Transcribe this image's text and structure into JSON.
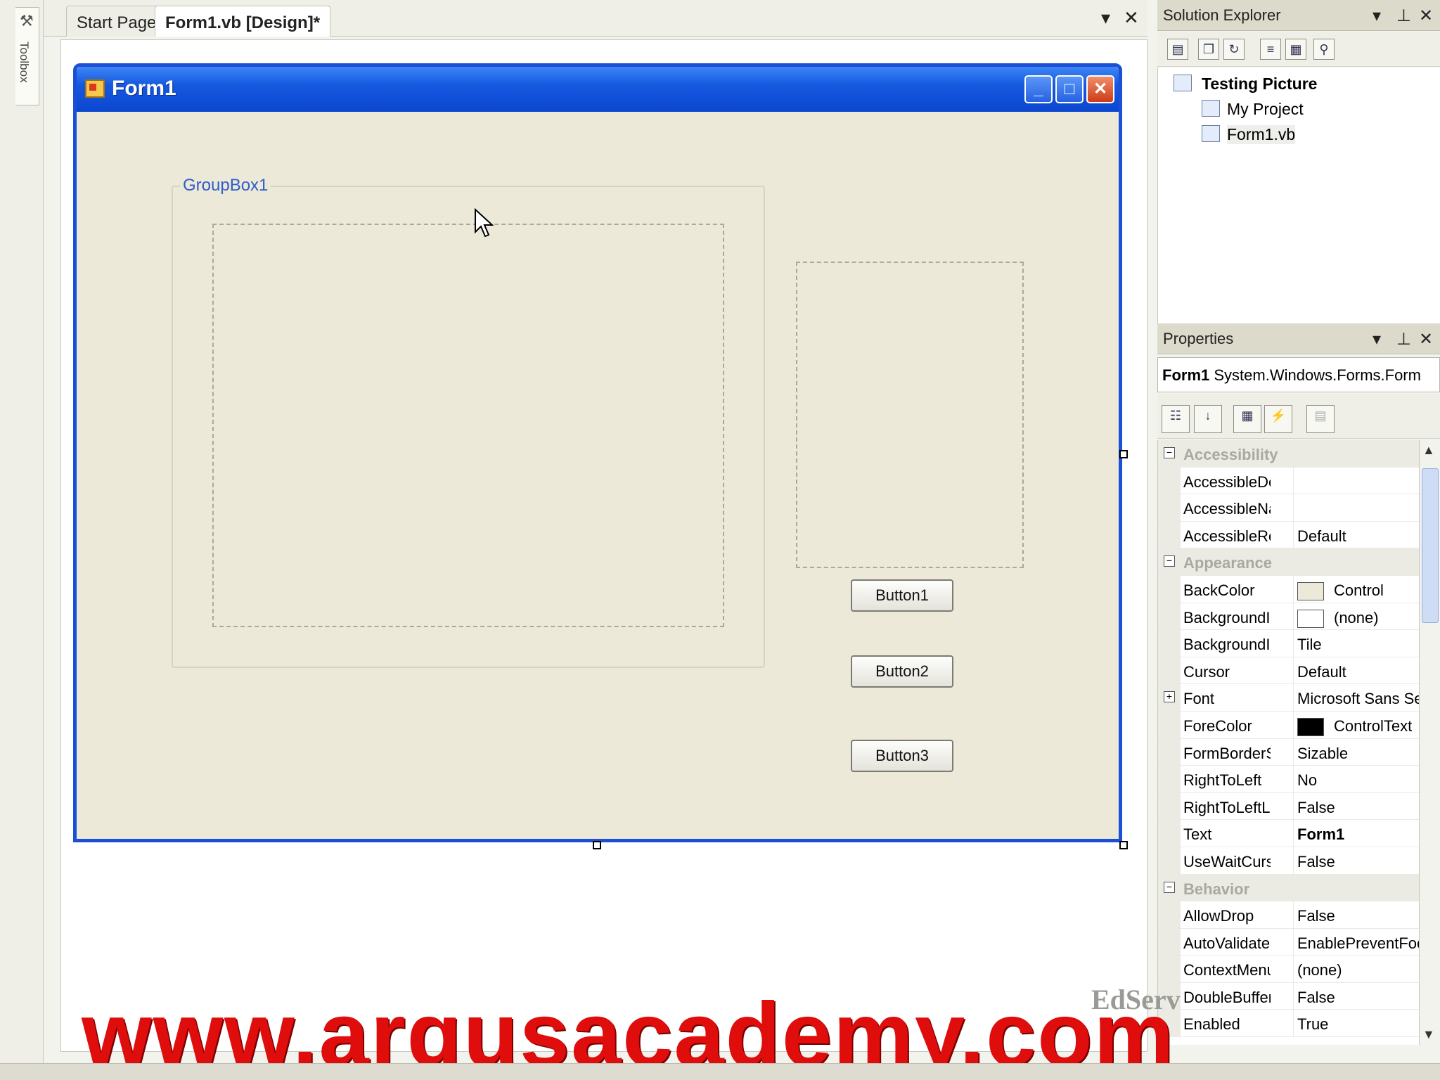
{
  "toolbox": {
    "label": "Toolbox"
  },
  "doc_tabs": {
    "tabs": [
      {
        "label": "Start Page"
      },
      {
        "label": "Form1.vb [Design]*"
      }
    ],
    "dropdown_glyph": "▾",
    "close_glyph": "✕"
  },
  "form": {
    "title": "Form1",
    "groupbox_label": "GroupBox1",
    "buttons": [
      {
        "label": "Button1"
      },
      {
        "label": "Button2"
      },
      {
        "label": "Button3"
      }
    ]
  },
  "solution_explorer": {
    "title": "Solution Explorer",
    "tree": {
      "root": "Testing Picture",
      "items": [
        "My Project",
        "Form1.vb"
      ]
    }
  },
  "properties": {
    "title": "Properties",
    "object_name": "Form1",
    "object_type": "System.Windows.Forms.Form",
    "sections": [
      {
        "name": "Accessibility",
        "rows": [
          {
            "name": "AccessibleDescri",
            "value": ""
          },
          {
            "name": "AccessibleName",
            "value": ""
          },
          {
            "name": "AccessibleRole",
            "value": "Default"
          }
        ]
      },
      {
        "name": "Appearance",
        "rows": [
          {
            "name": "BackColor",
            "value": "Control",
            "swatch": "#ece9d8"
          },
          {
            "name": "BackgroundImag",
            "value": "(none)",
            "swatch": "#ffffff"
          },
          {
            "name": "BackgroundImag",
            "value": "Tile"
          },
          {
            "name": "Cursor",
            "value": "Default"
          },
          {
            "name": "Font",
            "value": "Microsoft Sans Se",
            "expandable": true
          },
          {
            "name": "ForeColor",
            "value": "ControlText",
            "swatch": "#000000"
          },
          {
            "name": "FormBorderStyle",
            "value": "Sizable"
          },
          {
            "name": "RightToLeft",
            "value": "No"
          },
          {
            "name": "RightToLeftLayo",
            "value": "False"
          },
          {
            "name": "Text",
            "value": "Form1",
            "bold": true
          },
          {
            "name": "UseWaitCursor",
            "value": "False"
          }
        ]
      },
      {
        "name": "Behavior",
        "rows": [
          {
            "name": "AllowDrop",
            "value": "False"
          },
          {
            "name": "AutoValidate",
            "value": "EnablePreventFoc"
          },
          {
            "name": "ContextMenuStr",
            "value": "(none)"
          },
          {
            "name": "DoubleBuffered",
            "value": "False"
          },
          {
            "name": "Enabled",
            "value": "True"
          }
        ]
      }
    ]
  },
  "watermark": {
    "text": "www.argusacademy.com",
    "logo": "EdServ"
  },
  "colors": {
    "form_border": "#1b4fd6",
    "titlebar": "#0c46cf",
    "watermark": "#e00d0d",
    "form_bg": "#ece9d8"
  }
}
